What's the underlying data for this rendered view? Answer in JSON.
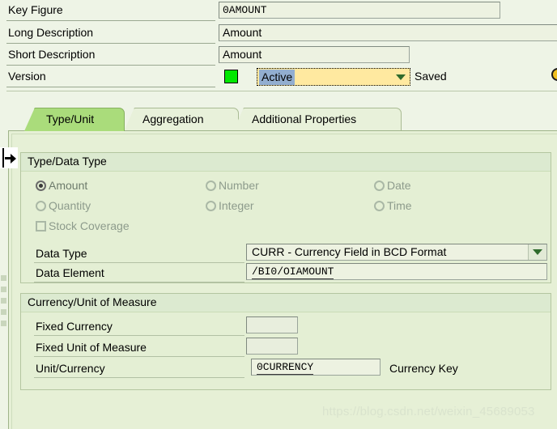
{
  "header": {
    "rows": [
      {
        "label": "Key Figure",
        "value": "0AMOUNT"
      },
      {
        "label": "Long Description",
        "value": "Amount"
      },
      {
        "label": "Short Description",
        "value": "Amount"
      },
      {
        "label": "Version",
        "value": "Active"
      }
    ],
    "version_status_label": "Saved",
    "status_light_color": "#00e800",
    "dropdown_arrow_color": "#2f6b2c"
  },
  "tabs": [
    {
      "label": "Type/Unit",
      "active": true
    },
    {
      "label": "Aggregation",
      "active": false
    },
    {
      "label": "Additional Properties",
      "active": false
    }
  ],
  "type_panel": {
    "title": "Type/Data Type",
    "options": [
      {
        "label": "Amount",
        "selected": true
      },
      {
        "label": "Number",
        "selected": false
      },
      {
        "label": "Date",
        "selected": false
      },
      {
        "label": "Quantity",
        "selected": false
      },
      {
        "label": "Integer",
        "selected": false
      },
      {
        "label": "Time",
        "selected": false
      }
    ],
    "checkbox": {
      "label": "Stock Coverage",
      "checked": false
    },
    "data_type": {
      "label": "Data Type",
      "value": "CURR - Currency Field in BCD Format"
    },
    "data_element": {
      "label": "Data Element",
      "value": "/BI0/OIAMOUNT"
    }
  },
  "currency_panel": {
    "title": "Currency/Unit of Measure",
    "fixed_currency": {
      "label": "Fixed Currency",
      "value": ""
    },
    "fixed_unit": {
      "label": "Fixed Unit of Measure",
      "value": ""
    },
    "unit_currency": {
      "label": "Unit/Currency",
      "value": "0CURRENCY",
      "suffix": "Currency Key"
    }
  },
  "watermark": "https://blog.csdn.net/weixin_45689053"
}
